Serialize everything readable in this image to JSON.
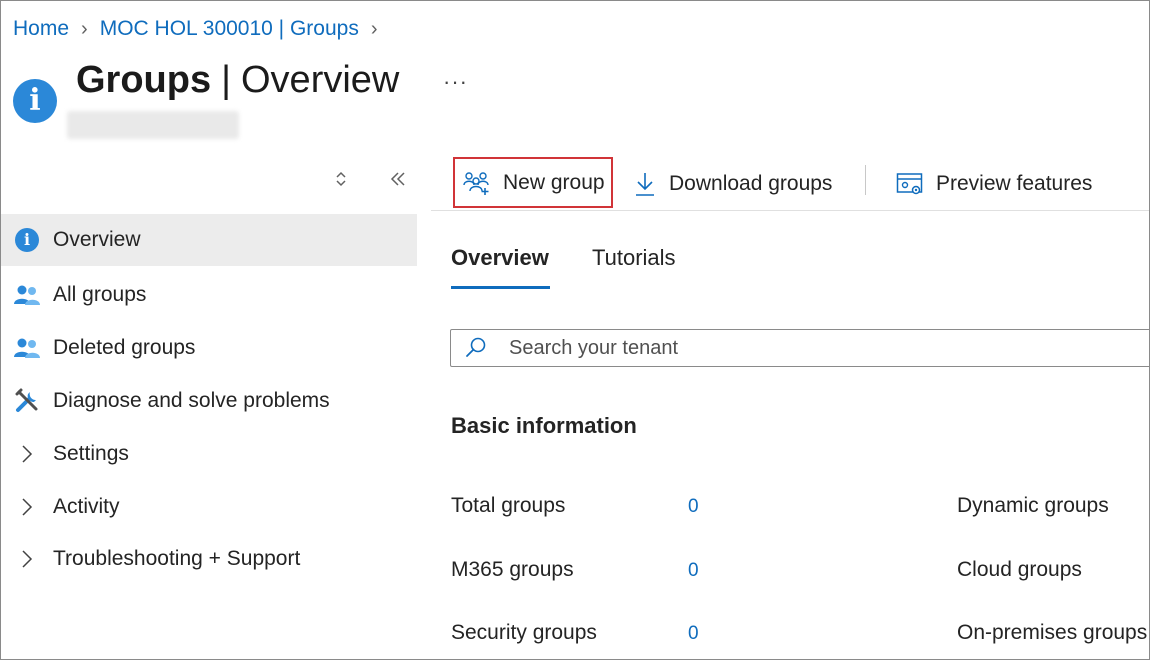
{
  "breadcrumb": {
    "items": [
      "Home",
      "MOC HOL 300010 | Groups"
    ]
  },
  "header": {
    "title_bold": "Groups",
    "title_sep": "|",
    "title_light": "Overview",
    "more_label": "···"
  },
  "sidebar": {
    "items": [
      {
        "label": "Overview",
        "icon": "info-icon",
        "active": true
      },
      {
        "label": "All groups",
        "icon": "group-icon"
      },
      {
        "label": "Deleted groups",
        "icon": "group-icon"
      },
      {
        "label": "Diagnose and solve problems",
        "icon": "wrench-icon"
      },
      {
        "label": "Settings",
        "icon": "chevron-right-icon"
      },
      {
        "label": "Activity",
        "icon": "chevron-right-icon"
      },
      {
        "label": "Troubleshooting + Support",
        "icon": "chevron-right-icon"
      }
    ]
  },
  "toolbar": {
    "new_group": "New group",
    "download_groups": "Download groups",
    "preview_features": "Preview features"
  },
  "tabs": [
    {
      "label": "Overview",
      "active": true
    },
    {
      "label": "Tutorials",
      "active": false
    }
  ],
  "search": {
    "placeholder": "Search your tenant"
  },
  "basic_info": {
    "title": "Basic information",
    "left_stats": [
      {
        "label": "Total groups",
        "value": "0"
      },
      {
        "label": "M365 groups",
        "value": "0"
      },
      {
        "label": "Security groups",
        "value": "0"
      }
    ],
    "right_stats": [
      {
        "label": "Dynamic groups"
      },
      {
        "label": "Cloud groups"
      },
      {
        "label": "On-premises groups"
      }
    ]
  },
  "colors": {
    "accent": "#0f6cbd",
    "highlight_border": "#d13438",
    "icon_blue": "#2b88d8"
  }
}
